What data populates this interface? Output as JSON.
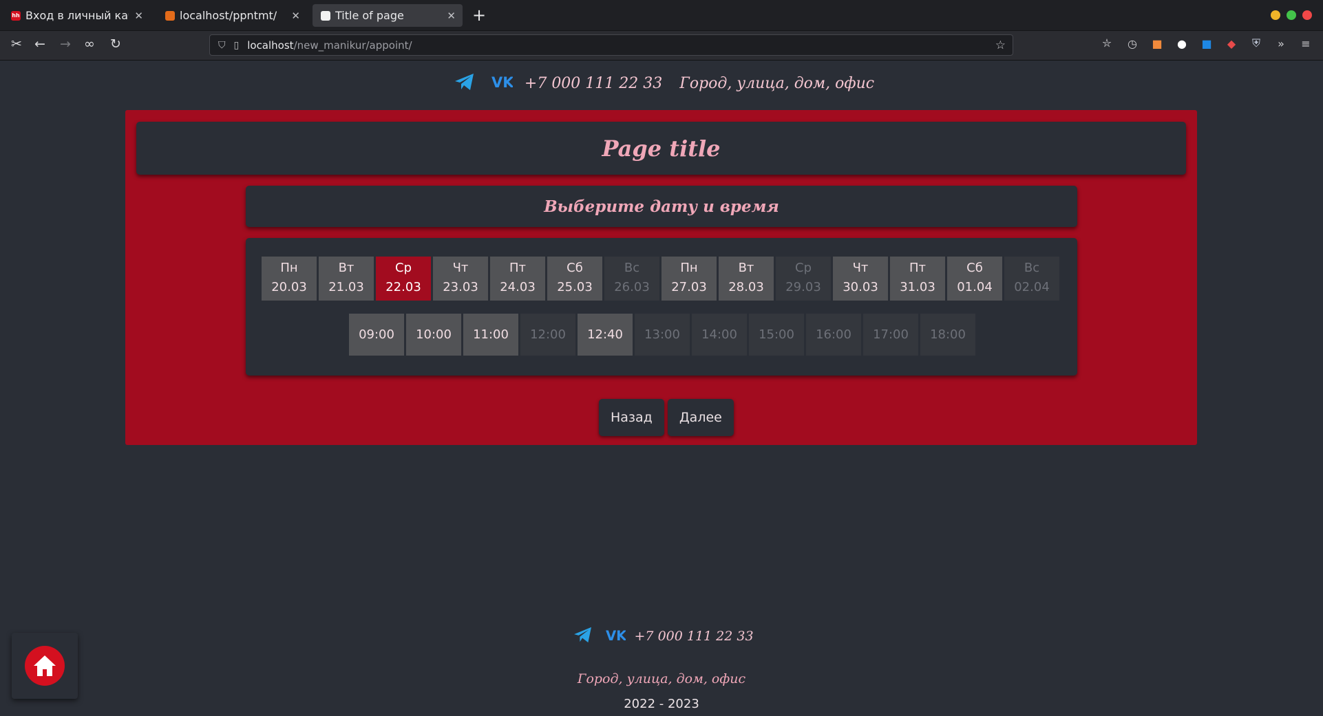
{
  "browser": {
    "tabs": [
      {
        "title": "Вход в личный кабинет",
        "favicon": "hh"
      },
      {
        "title": "localhost/ppntmt/",
        "favicon": ""
      },
      {
        "title": "Title of page",
        "favicon": ""
      }
    ],
    "url": {
      "host": "localhost",
      "path": "/new_manikur/appoint/"
    }
  },
  "header": {
    "phone": "+7 000 111 22 33",
    "address": "Город, улица, дом, офис"
  },
  "page": {
    "title": "Page title",
    "subtitle": "Выберите дату и время"
  },
  "days": [
    {
      "day": "Пн",
      "date": "20.03",
      "state": "available"
    },
    {
      "day": "Вт",
      "date": "21.03",
      "state": "available"
    },
    {
      "day": "Ср",
      "date": "22.03",
      "state": "selected"
    },
    {
      "day": "Чт",
      "date": "23.03",
      "state": "available"
    },
    {
      "day": "Пт",
      "date": "24.03",
      "state": "available"
    },
    {
      "day": "Сб",
      "date": "25.03",
      "state": "available"
    },
    {
      "day": "Вс",
      "date": "26.03",
      "state": "disabled"
    },
    {
      "day": "Пн",
      "date": "27.03",
      "state": "available"
    },
    {
      "day": "Вт",
      "date": "28.03",
      "state": "available"
    },
    {
      "day": "Ср",
      "date": "29.03",
      "state": "disabled"
    },
    {
      "day": "Чт",
      "date": "30.03",
      "state": "available"
    },
    {
      "day": "Пт",
      "date": "31.03",
      "state": "available"
    },
    {
      "day": "Сб",
      "date": "01.04",
      "state": "available"
    },
    {
      "day": "Вс",
      "date": "02.04",
      "state": "disabled"
    }
  ],
  "times": [
    {
      "time": "09:00",
      "state": "available"
    },
    {
      "time": "10:00",
      "state": "available"
    },
    {
      "time": "11:00",
      "state": "available"
    },
    {
      "time": "12:00",
      "state": "disabled"
    },
    {
      "time": "12:40",
      "state": "available"
    },
    {
      "time": "13:00",
      "state": "disabled"
    },
    {
      "time": "14:00",
      "state": "disabled"
    },
    {
      "time": "15:00",
      "state": "disabled"
    },
    {
      "time": "16:00",
      "state": "disabled"
    },
    {
      "time": "17:00",
      "state": "disabled"
    },
    {
      "time": "18:00",
      "state": "disabled"
    }
  ],
  "buttons": {
    "back": "Назад",
    "next": "Далее"
  },
  "footer": {
    "phone": "+7 000 111 22 33",
    "address": "Город, улица, дом, офис",
    "years": "2022 - 2023"
  },
  "colors": {
    "accent": "#a20c1f",
    "background": "#2a2e36",
    "script_text": "#f0a7b8"
  }
}
